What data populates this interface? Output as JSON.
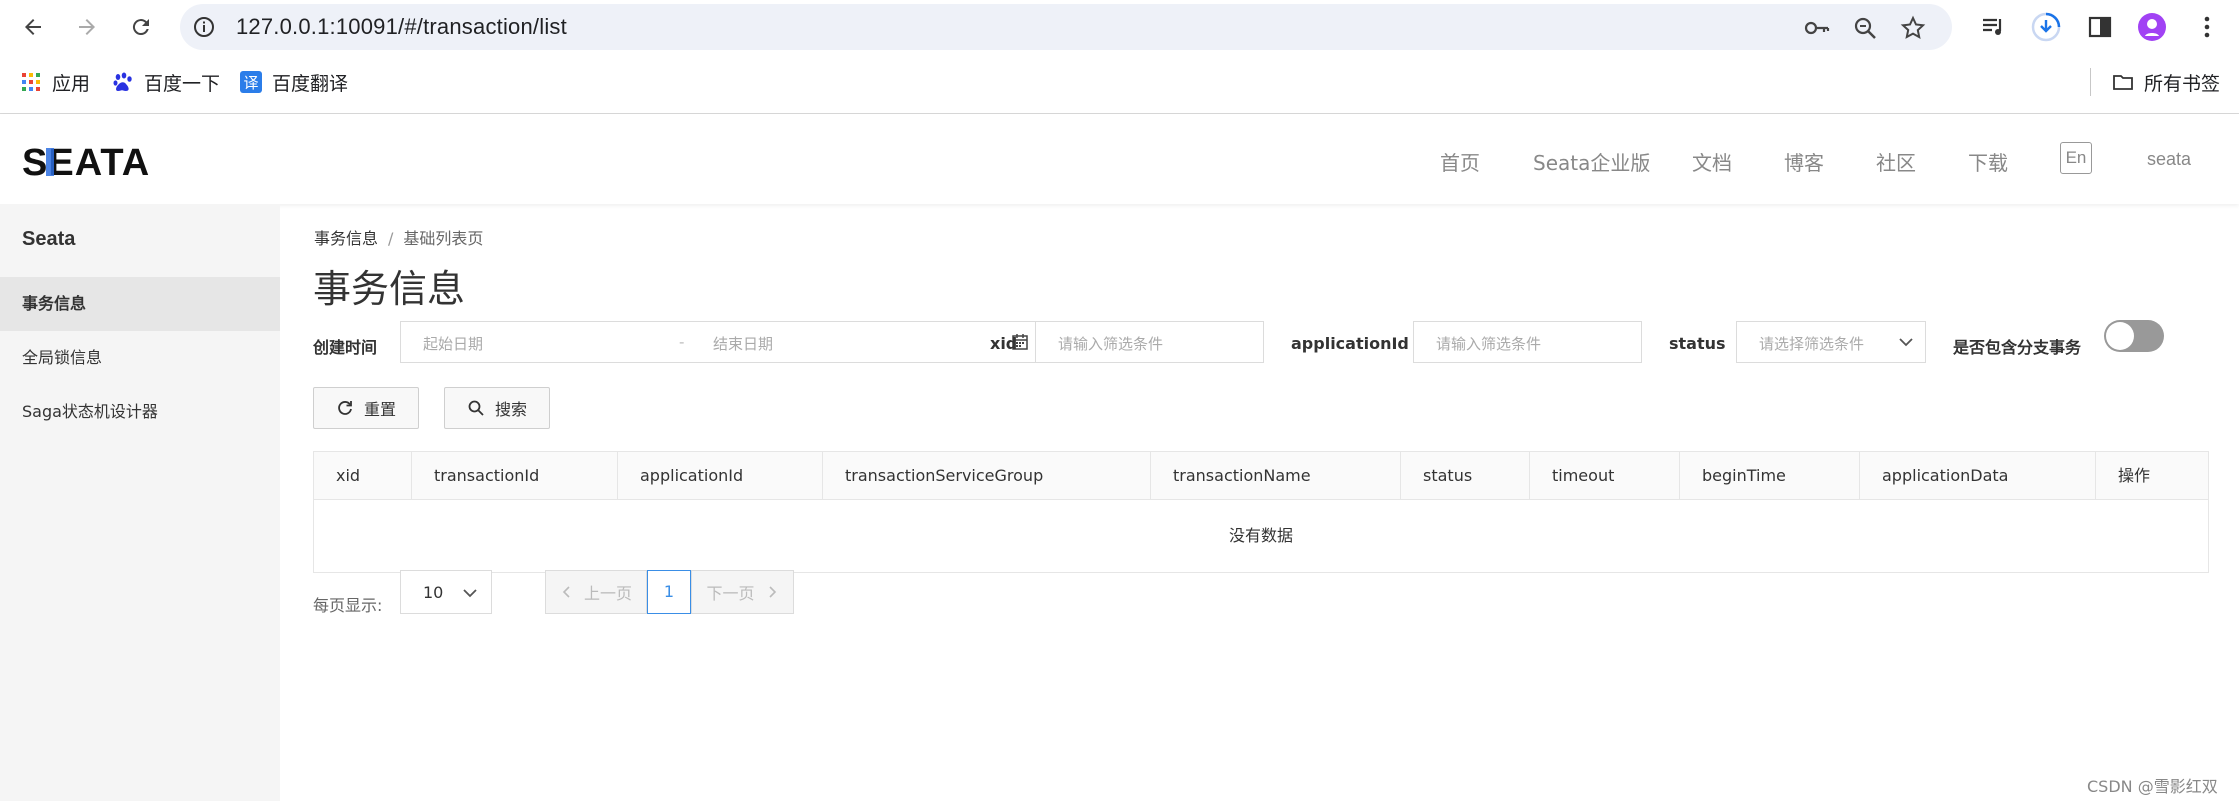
{
  "browser": {
    "url": "127.0.0.1:10091/#/transaction/list",
    "bookmarks": [
      {
        "label": "应用",
        "icon": "apps-grid-icon"
      },
      {
        "label": "百度一下",
        "icon": "baidu-paw-icon"
      },
      {
        "label": "百度翻译",
        "icon": "translate-icon",
        "icon_text": "译"
      }
    ],
    "all_bookmarks_label": "所有书签"
  },
  "header": {
    "logo_text": "SEATA",
    "nav": [
      "首页",
      "Seata企业版",
      "文档",
      "博客",
      "社区",
      "下载"
    ],
    "lang": "En",
    "user": "seata"
  },
  "sidebar": {
    "title": "Seata",
    "items": [
      {
        "label": "事务信息",
        "active": true
      },
      {
        "label": "全局锁信息",
        "active": false
      },
      {
        "label": "Saga状态机设计器",
        "active": false
      }
    ]
  },
  "main": {
    "breadcrumb": {
      "parent": "事务信息",
      "separator": "/",
      "current": "基础列表页"
    },
    "title": "事务信息",
    "filters": {
      "created_label": "创建时间",
      "start_placeholder": "起始日期",
      "range_separator": "-",
      "end_placeholder": "结束日期",
      "xid_label": "xid",
      "xid_placeholder": "请输入筛选条件",
      "app_label": "applicationId",
      "app_placeholder": "请输入筛选条件",
      "status_label": "status",
      "status_placeholder": "请选择筛选条件",
      "branch_label": "是否包含分支事务",
      "branch_on": false
    },
    "buttons": {
      "reset": "重置",
      "search": "搜索"
    },
    "table": {
      "columns": [
        "xid",
        "transactionId",
        "applicationId",
        "transactionServiceGroup",
        "transactionName",
        "status",
        "timeout",
        "beginTime",
        "applicationData",
        "操作"
      ],
      "empty_text": "没有数据"
    },
    "pagination": {
      "page_size_label": "每页显示:",
      "page_size": "10",
      "prev": "上一页",
      "current_page": "1",
      "next": "下一页"
    }
  },
  "watermark": "CSDN @雪影红双"
}
